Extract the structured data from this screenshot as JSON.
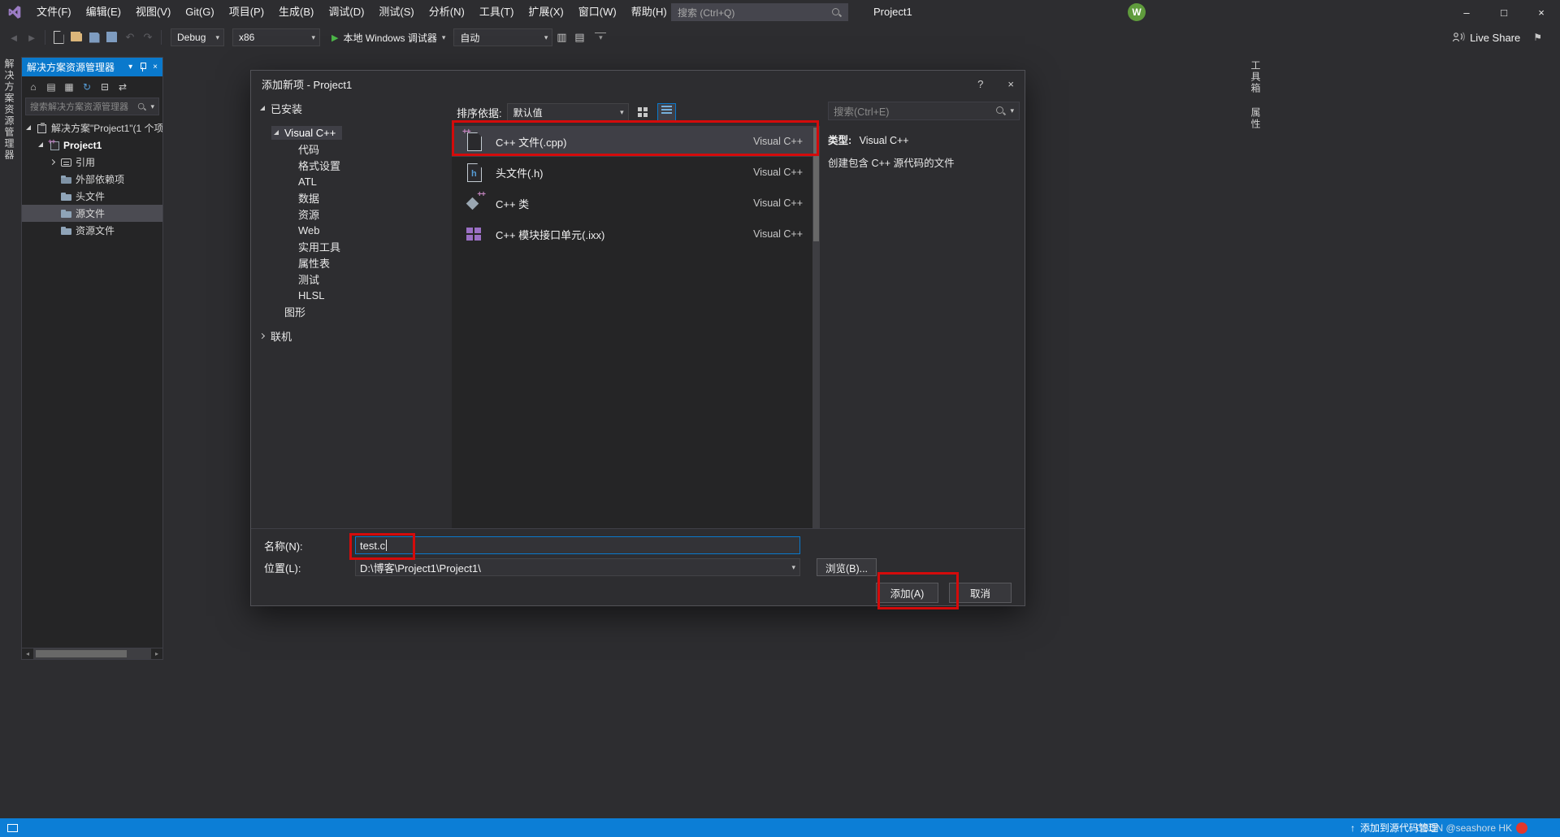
{
  "glyphs": {
    "chevron_down": "▾",
    "close": "×",
    "help": "?",
    "minimize": "–",
    "maximize": "□",
    "up_arrow": "↑",
    "play": "▶",
    "flag": "⚑",
    "scroll_left": "◂",
    "scroll_right": "▸"
  },
  "titlebar": {
    "menus": [
      "文件(F)",
      "编辑(E)",
      "视图(V)",
      "Git(G)",
      "项目(P)",
      "生成(B)",
      "调试(D)",
      "测试(S)",
      "分析(N)",
      "工具(T)",
      "扩展(X)",
      "窗口(W)",
      "帮助(H)"
    ],
    "search_placeholder": "搜索 (Ctrl+Q)",
    "project": "Project1",
    "avatar_initial": "W"
  },
  "toolbar": {
    "nav_icons": [
      {
        "icon": "navigate-back",
        "glyph": "◄",
        "dim": true
      },
      {
        "icon": "navigate-forward",
        "glyph": "►",
        "dim": true
      }
    ],
    "file_icons": [
      {
        "icon": "new-file",
        "glyph": ""
      },
      {
        "icon": "open-folder",
        "glyph": ""
      },
      {
        "icon": "save",
        "glyph": ""
      },
      {
        "icon": "save-all",
        "glyph": ""
      }
    ],
    "edit_icons": [
      {
        "icon": "undo",
        "glyph": "↶",
        "dim": true
      },
      {
        "icon": "redo",
        "glyph": "↷",
        "dim": true
      }
    ],
    "configuration": "Debug",
    "platform": "x86",
    "run_label": "本地 Windows 调试器",
    "watch_mode": "自动",
    "extra_icons": [
      {
        "icon": "profiler",
        "glyph": "▥"
      },
      {
        "icon": "find-in-files",
        "glyph": "▤"
      }
    ],
    "live_share": "Live Share"
  },
  "left_edge_tab": "解决方案资源管理器",
  "right_edge_tabs": [
    "工具箱",
    "属性"
  ],
  "solution_explorer": {
    "title": "解决方案资源管理器",
    "toolbar_icons": [
      {
        "icon": "home",
        "glyph": "⌂"
      },
      {
        "icon": "switch-views",
        "glyph": "▤"
      },
      {
        "icon": "pending-changes-filter",
        "glyph": "▦"
      },
      {
        "icon": "refresh",
        "glyph": "↻",
        "blue": true
      },
      {
        "icon": "collapse-all",
        "glyph": "⊟"
      },
      {
        "icon": "sync-with-active-document",
        "glyph": "⇄"
      }
    ],
    "search_placeholder": "搜索解决方案资源管理器",
    "tree": [
      {
        "label": "解决方案\"Project1\"(1 个项",
        "indent": 0,
        "icon": "solution",
        "arrow": "expanded"
      },
      {
        "label": "Project1",
        "indent": 1,
        "icon": "cpp-project",
        "arrow": "expanded",
        "bold": true
      },
      {
        "label": "引用",
        "indent": 2,
        "icon": "references",
        "arrow": "collapsed"
      },
      {
        "label": "外部依赖项",
        "indent": 2,
        "icon": "folder-deps"
      },
      {
        "label": "头文件",
        "indent": 2,
        "icon": "folder"
      },
      {
        "label": "源文件",
        "indent": 2,
        "icon": "folder",
        "selected": true
      },
      {
        "label": "资源文件",
        "indent": 2,
        "icon": "folder"
      }
    ]
  },
  "dialog": {
    "title": "添加新项 - Project1",
    "categories": [
      {
        "label": "已安装",
        "indent": 0,
        "arrow": "expanded"
      },
      {
        "label": "Visual C++",
        "indent": 1,
        "arrow": "expanded",
        "selected": true,
        "gap": true
      },
      {
        "label": "代码",
        "indent": 2
      },
      {
        "label": "格式设置",
        "indent": 2
      },
      {
        "label": "ATL",
        "indent": 2
      },
      {
        "label": "数据",
        "indent": 2
      },
      {
        "label": "资源",
        "indent": 2
      },
      {
        "label": "Web",
        "indent": 2
      },
      {
        "label": "实用工具",
        "indent": 2
      },
      {
        "label": "属性表",
        "indent": 2
      },
      {
        "label": "测试",
        "indent": 2
      },
      {
        "label": "HLSL",
        "indent": 2
      },
      {
        "label": "图形",
        "indent": 1
      },
      {
        "label": "联机",
        "indent": 0,
        "arrow": "collapsed",
        "gap": true
      }
    ],
    "sort": {
      "label": "排序依据:",
      "value": "默认值"
    },
    "templates": [
      {
        "name": "C++ 文件(.cpp)",
        "category": "Visual C++",
        "icon": "cpp-file",
        "selected": true
      },
      {
        "name": "头文件(.h)",
        "category": "Visual C++",
        "icon": "header-file"
      },
      {
        "name": "C++ 类",
        "category": "Visual C++",
        "icon": "cpp-class"
      },
      {
        "name": "C++ 模块接口单元(.ixx)",
        "category": "Visual C++",
        "icon": "cpp-module"
      }
    ],
    "search_placeholder": "搜索(Ctrl+E)",
    "info": {
      "type_label": "类型:",
      "type_value": "Visual C++",
      "description": "创建包含 C++ 源代码的文件"
    },
    "form": {
      "name_label": "名称(N):",
      "name_value": "test.c",
      "location_label": "位置(L):",
      "location_value": "D:\\博客\\Project1\\Project1\\",
      "browse_button": "浏览(B)...",
      "add_button": "添加(A)",
      "cancel_button": "取消"
    }
  },
  "statusbar": {
    "right_action": "添加到源代码管理",
    "watermark": "CSDN @seashore HK"
  }
}
